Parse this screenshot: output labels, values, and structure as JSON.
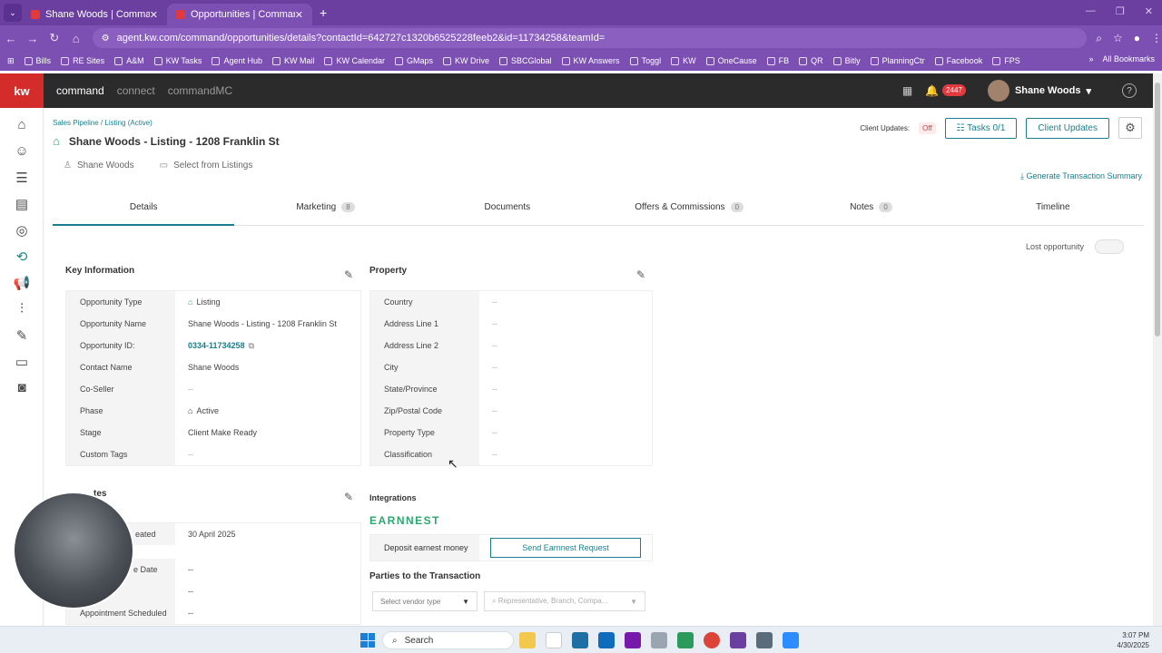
{
  "browser": {
    "tabs": [
      {
        "title": "Shane Woods | Command",
        "active": false
      },
      {
        "title": "Opportunities | Command",
        "active": true
      }
    ],
    "url": "agent.kw.com/command/opportunities/details?contactId=642727c1320b6525228feeb2&id=11734258&teamId=",
    "bookmarks": [
      "Bills",
      "RE Sites",
      "A&M",
      "KW Tasks",
      "Agent Hub",
      "KW Mail",
      "KW Calendar",
      "GMaps",
      "KW Drive",
      "SBCGlobal",
      "KW Answers",
      "Toggl",
      "KW",
      "OneCause",
      "FB",
      "QR",
      "Bitly",
      "PlanningCtr",
      "Facebook",
      "FPS"
    ],
    "all_bookmarks": "All Bookmarks"
  },
  "app": {
    "logo": "kw",
    "nav": [
      "command",
      "connect",
      "commandMC"
    ],
    "notification_count": "2447",
    "user_name": "Shane Woods"
  },
  "page": {
    "breadcrumb": "Sales Pipeline / Listing (Active)",
    "title": "Shane Woods - Listing - 1208 Franklin St",
    "contact": "Shane Woods",
    "select_listing": "Select from Listings",
    "client_updates_label": "Client Updates:",
    "client_updates_status": "Off",
    "tasks_button": "Tasks 0/1",
    "client_updates_button": "Client Updates",
    "generate_summary": "Generate Transaction Summary",
    "lost_opportunity": "Lost opportunity"
  },
  "tabs": [
    {
      "label": "Details",
      "count": ""
    },
    {
      "label": "Marketing",
      "count": "8"
    },
    {
      "label": "Documents",
      "count": ""
    },
    {
      "label": "Offers & Commissions",
      "count": "0"
    },
    {
      "label": "Notes",
      "count": "0"
    },
    {
      "label": "Timeline",
      "count": ""
    }
  ],
  "key_info": {
    "title": "Key Information",
    "rows": [
      {
        "k": "Opportunity Type",
        "v": "Listing"
      },
      {
        "k": "Opportunity Name",
        "v": "Shane Woods - Listing - 1208 Franklin St"
      },
      {
        "k": "Opportunity ID:",
        "v": "0334-11734258"
      },
      {
        "k": "Contact Name",
        "v": "Shane Woods"
      },
      {
        "k": "Co-Seller",
        "v": "--"
      },
      {
        "k": "Phase",
        "v": "Active"
      },
      {
        "k": "Stage",
        "v": "Client Make Ready"
      },
      {
        "k": "Custom Tags",
        "v": "--"
      }
    ]
  },
  "dates": {
    "title": "tes",
    "rows": [
      {
        "k": "eated",
        "v": "30 April 2025"
      },
      {
        "k": "e Date",
        "v": "--"
      },
      {
        "k": "",
        "v": "--"
      },
      {
        "k": "Appointment Scheduled",
        "v": "--"
      }
    ]
  },
  "property": {
    "title": "Property",
    "rows": [
      {
        "k": "Country",
        "v": "--"
      },
      {
        "k": "Address Line 1",
        "v": "--"
      },
      {
        "k": "Address Line 2",
        "v": "--"
      },
      {
        "k": "City",
        "v": "--"
      },
      {
        "k": "State/Province",
        "v": "--"
      },
      {
        "k": "Zip/Postal Code",
        "v": "--"
      },
      {
        "k": "Property Type",
        "v": "--"
      },
      {
        "k": "Classification",
        "v": "--"
      }
    ]
  },
  "integrations": {
    "title": "Integrations",
    "brand": "EARNNEST",
    "deposit_label": "Deposit earnest money",
    "send_button": "Send Earnnest Request"
  },
  "parties": {
    "title": "Parties to the Transaction",
    "vendor_placeholder": "Select vendor type",
    "rep_placeholder": "Representative, Branch, Compa..."
  },
  "taskbar": {
    "search": "Search",
    "time": "3:07 PM",
    "date": "4/30/2025"
  }
}
